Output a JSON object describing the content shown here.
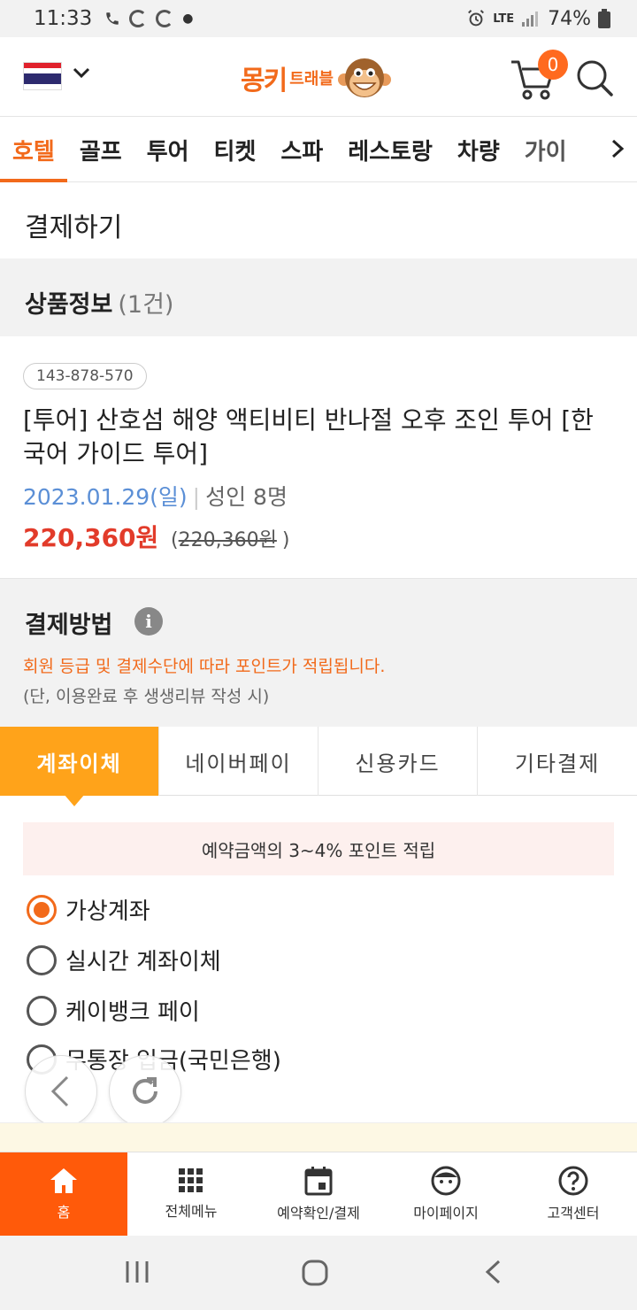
{
  "status_bar": {
    "time": "11:33",
    "network": "LTE",
    "battery": "74%"
  },
  "header": {
    "logo_text": "몽키",
    "logo_sub": "트래블",
    "cart_count": "0"
  },
  "category_tabs": [
    "호텔",
    "골프",
    "투어",
    "티켓",
    "스파",
    "레스토랑",
    "차량",
    "가이"
  ],
  "page": {
    "title": "결제하기"
  },
  "product_section": {
    "title": "상품정보",
    "count": "(1건)"
  },
  "product": {
    "code": "143-878-570",
    "name": "[투어] 산호섬 해양 액티비티 반나절 오후 조인 투어 [한국어 가이드 투어]",
    "date": "2023.01.29(일)",
    "separator": "|",
    "people": "성인 8명",
    "price": "220,360원",
    "orig_open": "(",
    "orig_price": "220,360원",
    "orig_close": ")"
  },
  "payment": {
    "title": "결제방법",
    "info_icon": "i",
    "note1": "회원 등급 및 결제수단에 따라 포인트가 적립됩니다.",
    "note2": "(단, 이용완료 후 생생리뷰 작성 시)",
    "tabs": [
      "계좌이체",
      "네이버페이",
      "신용카드",
      "기타결제"
    ],
    "banner": "예약금액의 3~4% 포인트 적립",
    "options": [
      "가상계좌",
      "실시간 계좌이체",
      "케이뱅크 페이",
      "무통장 입금(국민은행)"
    ]
  },
  "bottom_nav": [
    "홈",
    "전체메뉴",
    "예약확인/결제",
    "마이페이지",
    "고객센터"
  ],
  "colors": {
    "accent": "#f26a1b",
    "tab_active": "#ffa31a",
    "nav_active": "#ff5a0a",
    "price": "#e23b2a",
    "date": "#5b8fd6"
  }
}
